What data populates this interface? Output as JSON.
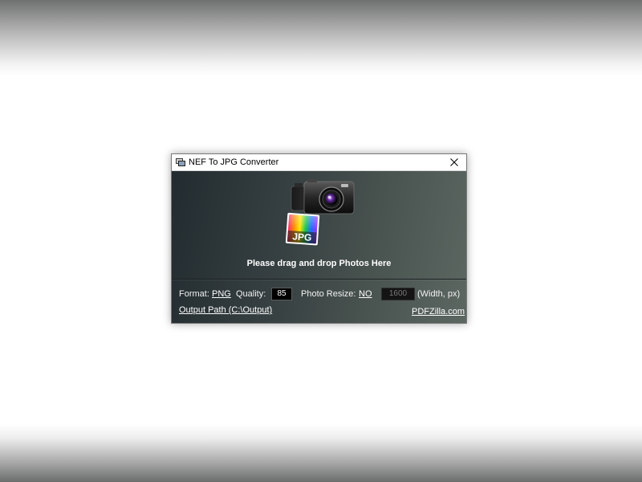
{
  "window": {
    "title": "NEF To JPG Converter"
  },
  "drop_zone": {
    "badge_text": "JPG",
    "instruction": "Please drag and drop Photos Here"
  },
  "options": {
    "format_label": "Format:",
    "format_value": "PNG",
    "quality_label": "Quality:",
    "quality_value": "85",
    "resize_label": "Photo Resize:",
    "resize_value": "NO",
    "width_value": "1600",
    "width_unit": "(Width, px)",
    "output_path": "Output Path (C:\\Output)",
    "site_link": "PDFZilla.com"
  }
}
